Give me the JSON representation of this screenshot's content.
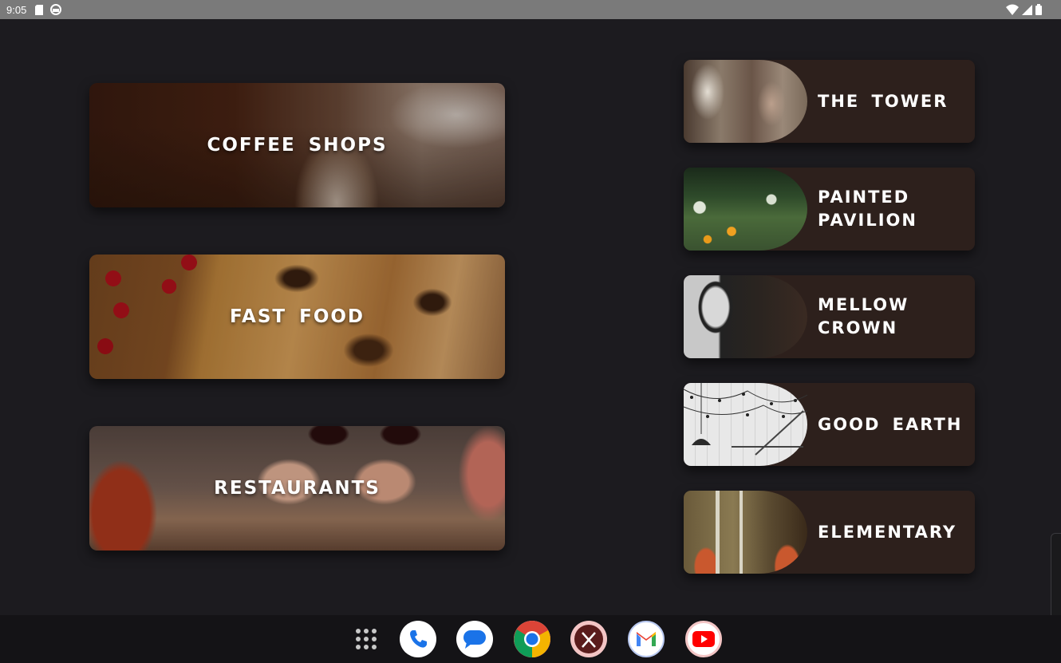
{
  "status_bar": {
    "time": "9:05",
    "left_icons": [
      "sd-card-icon",
      "android-icon"
    ],
    "right_icons": [
      "wifi-icon",
      "signal-icon",
      "battery-icon"
    ]
  },
  "categories": [
    {
      "label": "COFFEE SHOPS",
      "image": "coffee-cup-steam"
    },
    {
      "label": "FAST FOOD",
      "image": "pizza-with-tomatoes"
    },
    {
      "label": "RESTAURANTS",
      "image": "wine-toast-hands"
    }
  ],
  "places": [
    {
      "label": "THE TOWER",
      "image": "blurred-interior"
    },
    {
      "label": "PAINTED PAVILION",
      "image": "garden-bokeh"
    },
    {
      "label": "MELLOW CROWN",
      "image": "arched-window"
    },
    {
      "label": "GOOD EARTH",
      "image": "string-lights-ceiling"
    },
    {
      "label": "ELEMENTARY",
      "image": "copper-pendant-lamps"
    }
  ],
  "dock": {
    "apps": [
      "app-drawer-icon",
      "phone-icon",
      "messages-icon",
      "chrome-icon",
      "restaurant-app-icon",
      "gmail-icon",
      "youtube-icon"
    ]
  },
  "colors": {
    "background": "#1c1b1f",
    "card": "#2d201c",
    "status_bar": "#7a7a7a",
    "dock": "#141316"
  }
}
